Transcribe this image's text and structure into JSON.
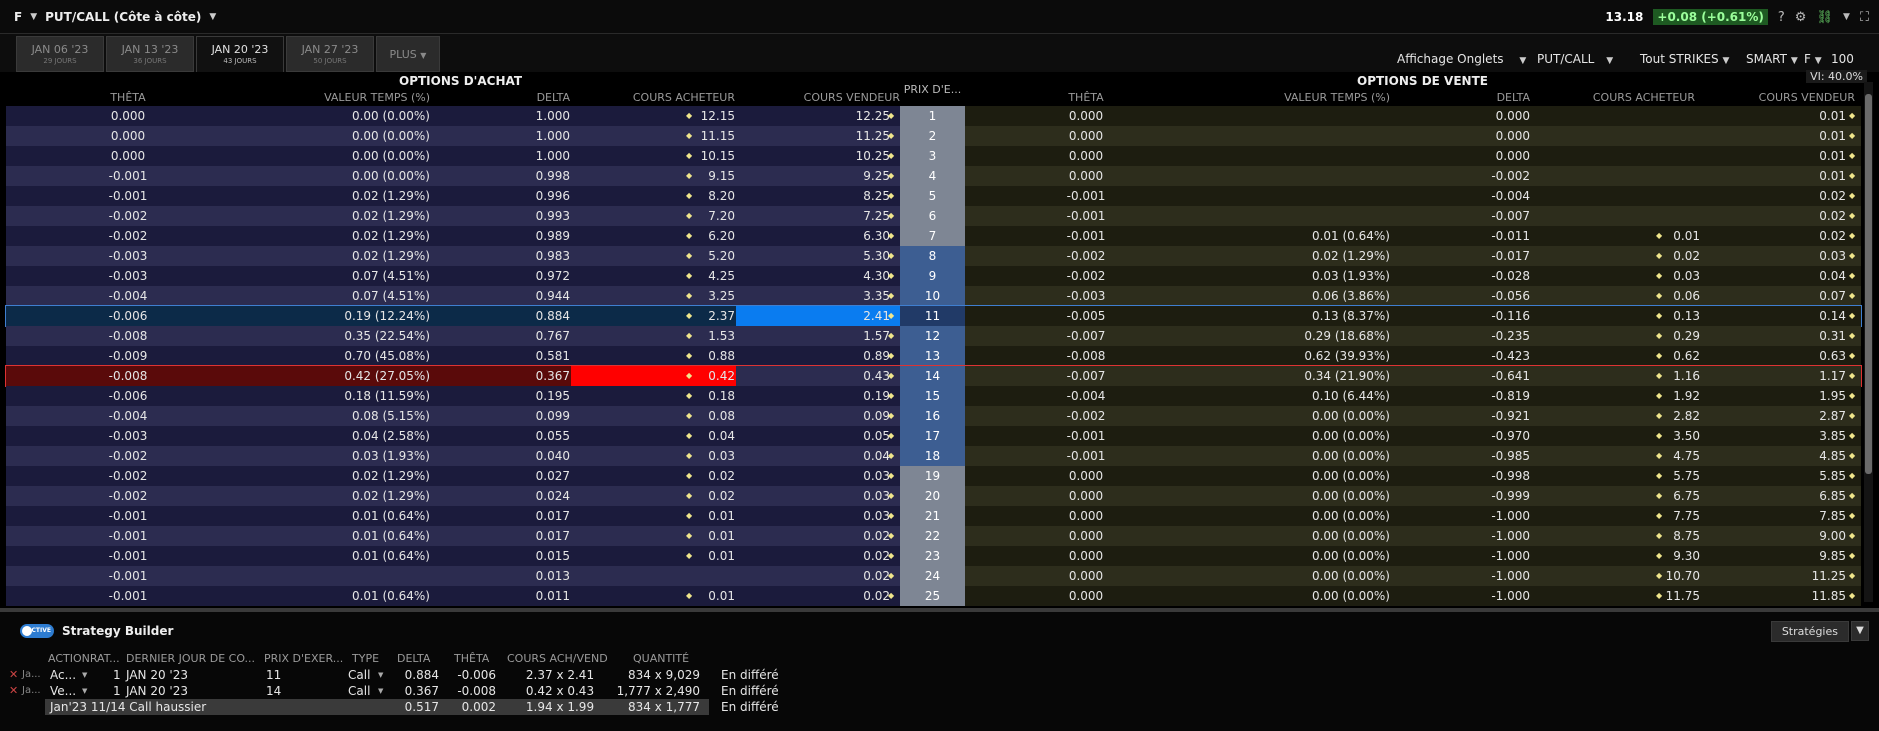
{
  "titlebar": {
    "symbol": "F",
    "title": "PUT/CALL (Côte à côte)",
    "price": "13.18",
    "change": "+0.08 (+0.61%)",
    "help": "?"
  },
  "tabs": [
    {
      "label": "JAN 06 '23",
      "sub": "29 JOURS",
      "active": false
    },
    {
      "label": "JAN 13 '23",
      "sub": "36 JOURS",
      "active": false
    },
    {
      "label": "JAN 20 '23",
      "sub": "43 JOURS",
      "active": true
    },
    {
      "label": "JAN 27 '23",
      "sub": "50 JOURS",
      "active": false
    }
  ],
  "plus_tab": "PLUS",
  "controls": {
    "display": "Affichage Onglets",
    "putcall": "PUT/CALL",
    "strikes": "Tout STRIKES",
    "exchange": "SMART",
    "symbol": "F",
    "qty": "100",
    "vi": "VI: 40.0%"
  },
  "headers": {
    "calls": "OPTIONS D'ACHAT",
    "puts": "OPTIONS DE VENTE",
    "strike": "PRIX D'E...",
    "theta": "THÊTA",
    "timeval": "VALEUR TEMPS (%)",
    "delta": "DELTA",
    "bid": "COURS ACHETEUR",
    "ask": "COURS VENDEUR"
  },
  "rows": [
    {
      "strike": "1",
      "c_theta": "0.000",
      "c_tv": "0.00 (0.00%)",
      "c_delta": "1.000",
      "c_bid": "12.15",
      "c_ask": "12.25",
      "p_theta": "0.000",
      "p_tv": "",
      "p_delta": "0.000",
      "p_bid": "",
      "p_ask": "0.01"
    },
    {
      "strike": "2",
      "c_theta": "0.000",
      "c_tv": "0.00 (0.00%)",
      "c_delta": "1.000",
      "c_bid": "11.15",
      "c_ask": "11.25",
      "p_theta": "0.000",
      "p_tv": "",
      "p_delta": "0.000",
      "p_bid": "",
      "p_ask": "0.01"
    },
    {
      "strike": "3",
      "c_theta": "0.000",
      "c_tv": "0.00 (0.00%)",
      "c_delta": "1.000",
      "c_bid": "10.15",
      "c_ask": "10.25",
      "p_theta": "0.000",
      "p_tv": "",
      "p_delta": "0.000",
      "p_bid": "",
      "p_ask": "0.01"
    },
    {
      "strike": "4",
      "c_theta": "-0.001",
      "c_tv": "0.00 (0.00%)",
      "c_delta": "0.998",
      "c_bid": "9.15",
      "c_ask": "9.25",
      "p_theta": "0.000",
      "p_tv": "",
      "p_delta": "-0.002",
      "p_bid": "",
      "p_ask": "0.01"
    },
    {
      "strike": "5",
      "c_theta": "-0.001",
      "c_tv": "0.02 (1.29%)",
      "c_delta": "0.996",
      "c_bid": "8.20",
      "c_ask": "8.25",
      "p_theta": "-0.001",
      "p_tv": "",
      "p_delta": "-0.004",
      "p_bid": "",
      "p_ask": "0.02"
    },
    {
      "strike": "6",
      "c_theta": "-0.002",
      "c_tv": "0.02 (1.29%)",
      "c_delta": "0.993",
      "c_bid": "7.20",
      "c_ask": "7.25",
      "p_theta": "-0.001",
      "p_tv": "",
      "p_delta": "-0.007",
      "p_bid": "",
      "p_ask": "0.02"
    },
    {
      "strike": "7",
      "c_theta": "-0.002",
      "c_tv": "0.02 (1.29%)",
      "c_delta": "0.989",
      "c_bid": "6.20",
      "c_ask": "6.30",
      "p_theta": "-0.001",
      "p_tv": "0.01 (0.64%)",
      "p_delta": "-0.011",
      "p_bid": "0.01",
      "p_ask": "0.02"
    },
    {
      "strike": "8",
      "c_theta": "-0.003",
      "c_tv": "0.02 (1.29%)",
      "c_delta": "0.983",
      "c_bid": "5.20",
      "c_ask": "5.30",
      "p_theta": "-0.002",
      "p_tv": "0.02 (1.29%)",
      "p_delta": "-0.017",
      "p_bid": "0.02",
      "p_ask": "0.03"
    },
    {
      "strike": "9",
      "c_theta": "-0.003",
      "c_tv": "0.07 (4.51%)",
      "c_delta": "0.972",
      "c_bid": "4.25",
      "c_ask": "4.30",
      "p_theta": "-0.002",
      "p_tv": "0.03 (1.93%)",
      "p_delta": "-0.028",
      "p_bid": "0.03",
      "p_ask": "0.04"
    },
    {
      "strike": "10",
      "c_theta": "-0.004",
      "c_tv": "0.07 (4.51%)",
      "c_delta": "0.944",
      "c_bid": "3.25",
      "c_ask": "3.35",
      "p_theta": "-0.003",
      "p_tv": "0.06 (3.86%)",
      "p_delta": "-0.056",
      "p_bid": "0.06",
      "p_ask": "0.07"
    },
    {
      "strike": "11",
      "c_theta": "-0.006",
      "c_tv": "0.19 (12.24%)",
      "c_delta": "0.884",
      "c_bid": "2.37",
      "c_ask": "2.41",
      "p_theta": "-0.005",
      "p_tv": "0.13 (8.37%)",
      "p_delta": "-0.116",
      "p_bid": "0.13",
      "p_ask": "0.14"
    },
    {
      "strike": "12",
      "c_theta": "-0.008",
      "c_tv": "0.35 (22.54%)",
      "c_delta": "0.767",
      "c_bid": "1.53",
      "c_ask": "1.57",
      "p_theta": "-0.007",
      "p_tv": "0.29 (18.68%)",
      "p_delta": "-0.235",
      "p_bid": "0.29",
      "p_ask": "0.31"
    },
    {
      "strike": "13",
      "c_theta": "-0.009",
      "c_tv": "0.70 (45.08%)",
      "c_delta": "0.581",
      "c_bid": "0.88",
      "c_ask": "0.89",
      "p_theta": "-0.008",
      "p_tv": "0.62 (39.93%)",
      "p_delta": "-0.423",
      "p_bid": "0.62",
      "p_ask": "0.63"
    },
    {
      "strike": "14",
      "c_theta": "-0.008",
      "c_tv": "0.42 (27.05%)",
      "c_delta": "0.367",
      "c_bid": "0.42",
      "c_ask": "0.43",
      "p_theta": "-0.007",
      "p_tv": "0.34 (21.90%)",
      "p_delta": "-0.641",
      "p_bid": "1.16",
      "p_ask": "1.17"
    },
    {
      "strike": "15",
      "c_theta": "-0.006",
      "c_tv": "0.18 (11.59%)",
      "c_delta": "0.195",
      "c_bid": "0.18",
      "c_ask": "0.19",
      "p_theta": "-0.004",
      "p_tv": "0.10 (6.44%)",
      "p_delta": "-0.819",
      "p_bid": "1.92",
      "p_ask": "1.95"
    },
    {
      "strike": "16",
      "c_theta": "-0.004",
      "c_tv": "0.08 (5.15%)",
      "c_delta": "0.099",
      "c_bid": "0.08",
      "c_ask": "0.09",
      "p_theta": "-0.002",
      "p_tv": "0.00 (0.00%)",
      "p_delta": "-0.921",
      "p_bid": "2.82",
      "p_ask": "2.87"
    },
    {
      "strike": "17",
      "c_theta": "-0.003",
      "c_tv": "0.04 (2.58%)",
      "c_delta": "0.055",
      "c_bid": "0.04",
      "c_ask": "0.05",
      "p_theta": "-0.001",
      "p_tv": "0.00 (0.00%)",
      "p_delta": "-0.970",
      "p_bid": "3.50",
      "p_ask": "3.85"
    },
    {
      "strike": "18",
      "c_theta": "-0.002",
      "c_tv": "0.03 (1.93%)",
      "c_delta": "0.040",
      "c_bid": "0.03",
      "c_ask": "0.04",
      "p_theta": "-0.001",
      "p_tv": "0.00 (0.00%)",
      "p_delta": "-0.985",
      "p_bid": "4.75",
      "p_ask": "4.85"
    },
    {
      "strike": "19",
      "c_theta": "-0.002",
      "c_tv": "0.02 (1.29%)",
      "c_delta": "0.027",
      "c_bid": "0.02",
      "c_ask": "0.03",
      "p_theta": "0.000",
      "p_tv": "0.00 (0.00%)",
      "p_delta": "-0.998",
      "p_bid": "5.75",
      "p_ask": "5.85"
    },
    {
      "strike": "20",
      "c_theta": "-0.002",
      "c_tv": "0.02 (1.29%)",
      "c_delta": "0.024",
      "c_bid": "0.02",
      "c_ask": "0.03",
      "p_theta": "0.000",
      "p_tv": "0.00 (0.00%)",
      "p_delta": "-0.999",
      "p_bid": "6.75",
      "p_ask": "6.85"
    },
    {
      "strike": "21",
      "c_theta": "-0.001",
      "c_tv": "0.01 (0.64%)",
      "c_delta": "0.017",
      "c_bid": "0.01",
      "c_ask": "0.03",
      "p_theta": "0.000",
      "p_tv": "0.00 (0.00%)",
      "p_delta": "-1.000",
      "p_bid": "7.75",
      "p_ask": "7.85"
    },
    {
      "strike": "22",
      "c_theta": "-0.001",
      "c_tv": "0.01 (0.64%)",
      "c_delta": "0.017",
      "c_bid": "0.01",
      "c_ask": "0.02",
      "p_theta": "0.000",
      "p_tv": "0.00 (0.00%)",
      "p_delta": "-1.000",
      "p_bid": "8.75",
      "p_ask": "9.00"
    },
    {
      "strike": "23",
      "c_theta": "-0.001",
      "c_tv": "0.01 (0.64%)",
      "c_delta": "0.015",
      "c_bid": "0.01",
      "c_ask": "0.02",
      "p_theta": "0.000",
      "p_tv": "0.00 (0.00%)",
      "p_delta": "-1.000",
      "p_bid": "9.30",
      "p_ask": "9.85"
    },
    {
      "strike": "24",
      "c_theta": "-0.001",
      "c_tv": "",
      "c_delta": "0.013",
      "c_bid": "",
      "c_ask": "0.02",
      "p_theta": "0.000",
      "p_tv": "0.00 (0.00%)",
      "p_delta": "-1.000",
      "p_bid": "10.70",
      "p_ask": "11.25"
    },
    {
      "strike": "25",
      "c_theta": "-0.001",
      "c_tv": "0.01 (0.64%)",
      "c_delta": "0.011",
      "c_bid": "0.01",
      "c_ask": "0.02",
      "p_theta": "0.000",
      "p_tv": "0.00 (0.00%)",
      "p_delta": "-1.000",
      "p_bid": "11.75",
      "p_ask": "11.85"
    }
  ],
  "colors": {
    "call_row_a": "#1b1b3c",
    "call_row_b": "#2c2c50",
    "put_row_a": "#1d1d10",
    "put_row_b": "#2d2d1c",
    "strike_itm": "#3d5e92",
    "strike_otm": "#7e8694",
    "ask_highlight": "#0a7cf0",
    "bid_highlight": "#ff0000",
    "row_highlight_blue": "#0c2a48",
    "row_highlight_red": "#5a0a0a"
  },
  "strategy": {
    "toggle_label": "ACTIVE",
    "title": "Strategy Builder",
    "btn": "Stratégies",
    "headers": {
      "action": "ACTIONRAT...",
      "lastday": "DERNIER JOUR DE CO...",
      "strike": "PRIX D'EXER...",
      "type": "TYPE",
      "delta": "DELTA",
      "theta": "THÊTA",
      "bidask": "COURS ACH/VEND",
      "qty": "QUANTITÉ"
    },
    "legs": [
      {
        "prefix": "Ja...",
        "action": "Ac...",
        "ratio": "1",
        "lastday": "JAN 20 '23",
        "strike": "11",
        "type": "Call",
        "delta": "0.884",
        "theta": "-0.006",
        "bidask": "2.37 x 2.41",
        "qty": "834 x 9,029",
        "status": "En différé"
      },
      {
        "prefix": "Ja...",
        "action": "Ve...",
        "ratio": "1",
        "lastday": "JAN 20 '23",
        "strike": "14",
        "type": "Call",
        "delta": "0.367",
        "theta": "-0.008",
        "bidask": "0.42 x 0.43",
        "qty": "1,777 x 2,490",
        "status": "En différé"
      }
    ],
    "summary": {
      "label": "Jan'23 11/14 Call haussier",
      "delta": "0.517",
      "theta": "0.002",
      "bidask": "1.94 x 1.99",
      "qty": "834 x 1,777",
      "status": "En différé"
    }
  }
}
